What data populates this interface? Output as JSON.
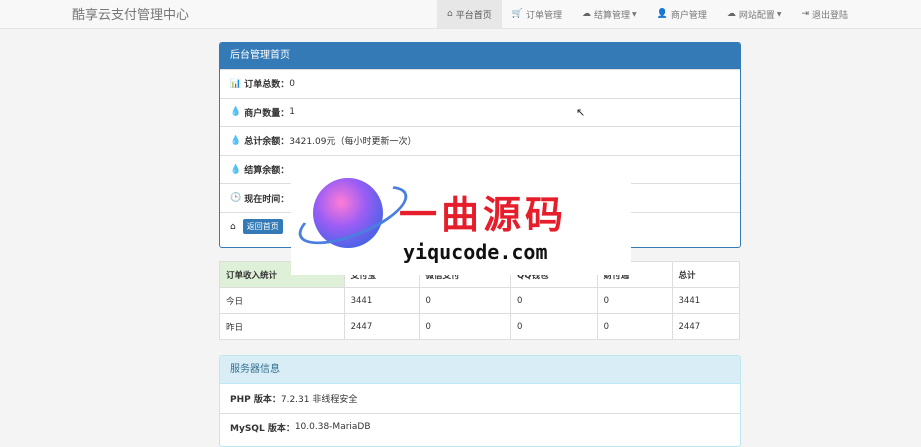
{
  "brand": "酷享云支付管理中心",
  "nav": [
    {
      "icon": "home-icon",
      "glyph": "⌂",
      "label": "平台首页",
      "active": true,
      "dropdown": false
    },
    {
      "icon": "cart-icon",
      "glyph": "🛒",
      "label": "订单管理",
      "active": false,
      "dropdown": false
    },
    {
      "icon": "cloud-icon",
      "glyph": "☁",
      "label": "结算管理",
      "active": false,
      "dropdown": true
    },
    {
      "icon": "user-icon",
      "glyph": "👤",
      "label": "商户管理",
      "active": false,
      "dropdown": false
    },
    {
      "icon": "cloud-icon",
      "glyph": "☁",
      "label": "网站配置",
      "active": false,
      "dropdown": true
    },
    {
      "icon": "logout-icon",
      "glyph": "⇥",
      "label": "退出登陆",
      "active": false,
      "dropdown": false
    }
  ],
  "main_panel": {
    "title": "后台管理首页",
    "rows": [
      {
        "icon": "bar-chart-icon",
        "glyph": "▮",
        "label": "订单总数：",
        "value": "0"
      },
      {
        "icon": "drop-icon",
        "glyph": "💧",
        "label": "商户数量：",
        "value": "1"
      },
      {
        "icon": "drop-icon",
        "glyph": "💧",
        "label": "总计余额：",
        "value": "3421.09元（每小时更新一次）"
      },
      {
        "icon": "drop-icon",
        "glyph": "💧",
        "label": "结算余额：",
        "value": ""
      },
      {
        "icon": "clock-icon",
        "glyph": "🕒",
        "label": "现在时间：",
        "value": ""
      }
    ],
    "home_button": "返回首页"
  },
  "stats_table": {
    "headers": [
      "订单收入统计",
      "支付宝",
      "微信支付",
      "QQ钱包",
      "财付通",
      "总计"
    ],
    "rows": [
      [
        "今日",
        "3441",
        "0",
        "0",
        "0",
        "3441"
      ],
      [
        "昨日",
        "2447",
        "0",
        "0",
        "0",
        "2447"
      ]
    ]
  },
  "server_panel": {
    "title": "服务器信息",
    "rows": [
      {
        "label": "PHP 版本：",
        "value": "7.2.31 非线程安全"
      },
      {
        "label": "MySQL 版本：",
        "value": "10.0.38-MariaDB"
      }
    ]
  },
  "watermark": {
    "title": "一曲源码",
    "url": "yiqucode.com"
  },
  "colors": {
    "primary": "#337ab7",
    "success_bg": "#dff0d8",
    "info_bg": "#d9edf7",
    "watermark_red": "#e61e2b"
  }
}
